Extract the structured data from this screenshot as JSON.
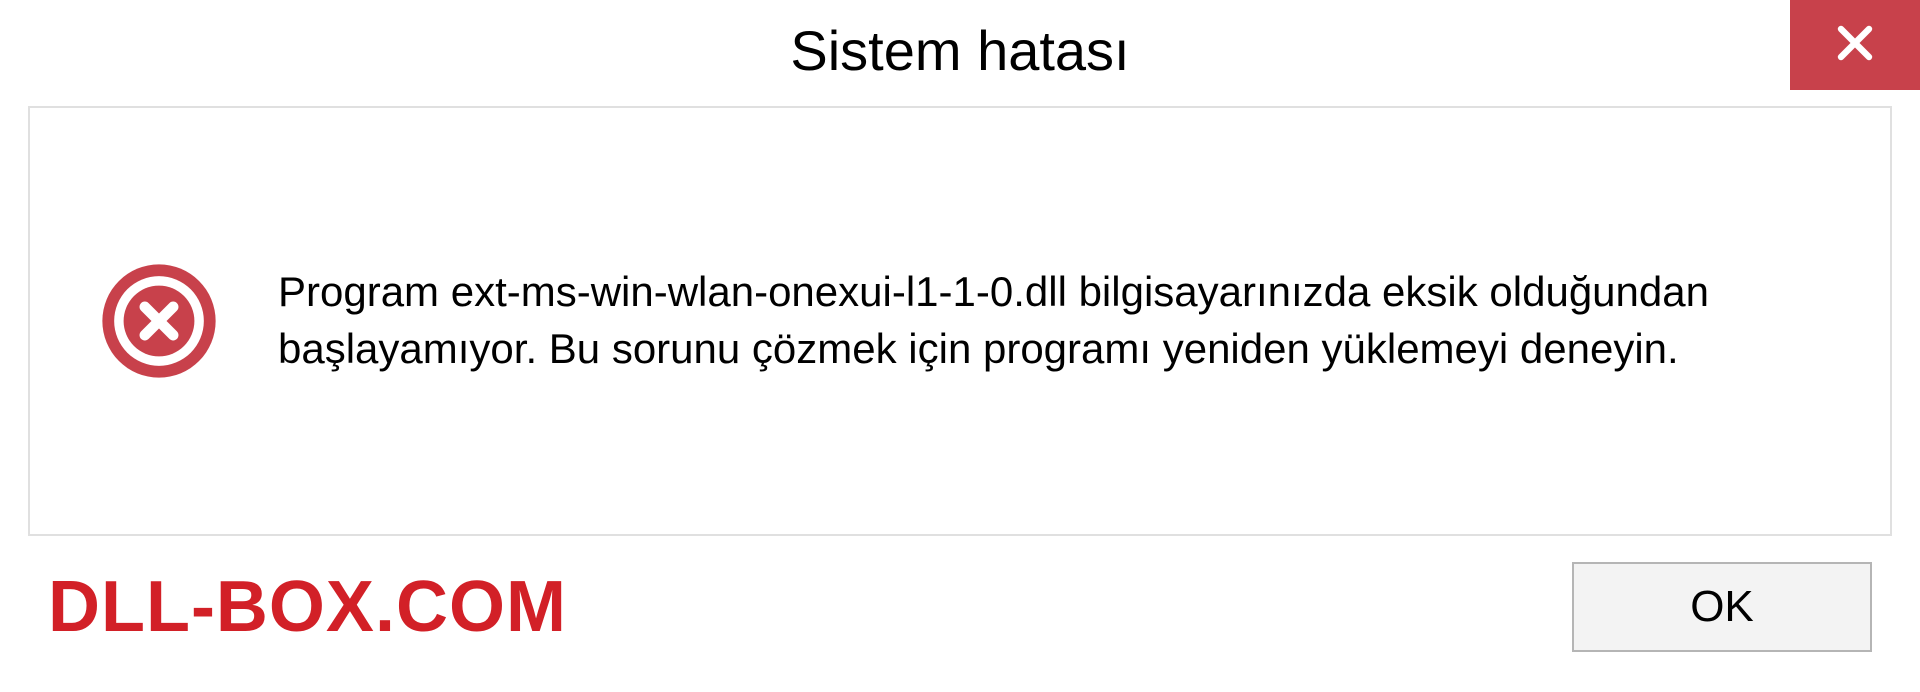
{
  "titlebar": {
    "title": "Sistem hatası"
  },
  "dialog": {
    "message": "Program ext-ms-win-wlan-onexui-l1-1-0.dll bilgisayarınızda eksik olduğundan başlayamıyor. Bu sorunu çözmek için programı yeniden yüklemeyi deneyin."
  },
  "footer": {
    "watermark": "DLL-BOX.COM",
    "ok_label": "OK"
  },
  "colors": {
    "close_bg": "#c8414b",
    "error_icon": "#c8414b",
    "watermark": "#d22027"
  }
}
